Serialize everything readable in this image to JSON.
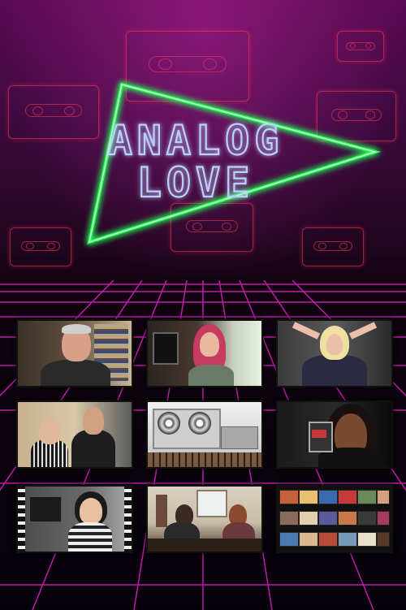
{
  "poster": {
    "title_line1": "ANALOG",
    "title_line2": "LOVE",
    "colors": {
      "background_top": "#5a0a52",
      "triangle_glow": "#2bff5a",
      "title_outline": "#bcd0ff",
      "grid_lines": "#e020c8",
      "cassette_neon": "#ff3c5a"
    }
  },
  "frames": [
    {
      "scene": "man-with-bookshelves"
    },
    {
      "scene": "woman-red-hair-holding-cassette"
    },
    {
      "scene": "blonde-woman-hands-on-head"
    },
    {
      "scene": "couple-in-kitchen"
    },
    {
      "scene": "reel-to-reel-tape-recorder"
    },
    {
      "scene": "woman-holding-cassette-to-camera"
    },
    {
      "scene": "child-with-headphones-filmstrip"
    },
    {
      "scene": "people-at-table-in-room"
    },
    {
      "scene": "grid-of-photos-collage"
    }
  ]
}
